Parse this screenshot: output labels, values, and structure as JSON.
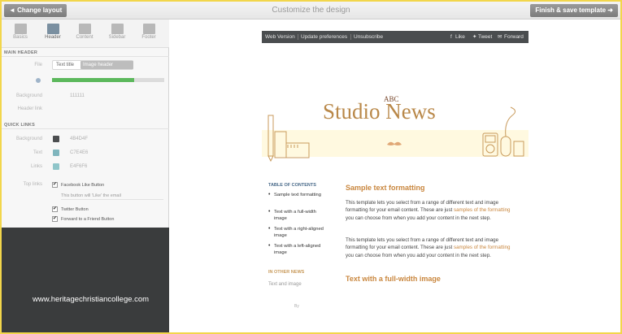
{
  "topbar": {
    "back_label": "◄ Change layout",
    "title": "Customize the design",
    "finish_label": "Finish & save template ➜"
  },
  "tabs": [
    {
      "label": "Basics",
      "icon": "scissors-icon"
    },
    {
      "label": "Header",
      "icon": "header-layout-icon"
    },
    {
      "label": "Content",
      "icon": "content-layout-icon"
    },
    {
      "label": "Sidebar",
      "icon": "sidebar-layout-icon"
    },
    {
      "label": "Footer",
      "icon": "footer-layout-icon"
    }
  ],
  "main_header": {
    "section": "MAIN HEADER",
    "file_label": "File",
    "seg_text": "Text title",
    "seg_image": "Image header",
    "slider_fraction": 0.73,
    "background_label": "Background",
    "background_value": "111111",
    "header_link_label": "Header link"
  },
  "quick_links": {
    "section": "QUICK LINKS",
    "rows": [
      {
        "label": "Background",
        "value": "4B4D4F",
        "color": "#4b4d4f"
      },
      {
        "label": "Text",
        "value": "C7E4E6",
        "color": "#7fb5bd"
      },
      {
        "label": "Links",
        "value": "E4F6F6",
        "color": "#8fc5c9"
      }
    ],
    "buttons_label": "Top links",
    "checks": [
      {
        "label": "Facebook Like Button",
        "checked": "✔"
      },
      {
        "label": "Twitter Button",
        "checked": "✔"
      },
      {
        "label": "Forward to a Friend Button",
        "checked": "✔"
      }
    ],
    "like_input": "This button will 'Like' the email"
  },
  "watermark": "www.heritagechristiancollege.com",
  "email": {
    "bar_links": [
      "Web Version",
      "Update preferences",
      "Unsubscribe"
    ],
    "social": [
      "Like",
      "Tweet",
      "Forward"
    ],
    "brand_small": "ABC",
    "brand_big": "Studio News",
    "toc_head": "TABLE OF CONTENTS",
    "toc": [
      "Sample text formatting",
      "Text with a full-width image",
      "Text with a right-aligned image",
      "Text with a left-aligned image"
    ],
    "news_head": "IN OTHER NEWS",
    "news_item": "Text and image",
    "by_text": "By",
    "h1": "Sample text formatting",
    "p1_a": "This template lets you select from a range of different text and image formatting for your email content. These are just ",
    "p1_link": "samples of the formatting",
    "p1_b": " you can choose from when you add your content in the next step.",
    "p2_a": "This template lets you select from a range of different text and image formatting for your email content. These are just ",
    "p2_link": "samples of the formatting",
    "p2_b": " you can choose from when you add your content in the next step.",
    "h2": "Text with a full-width image"
  },
  "colors": {
    "accent": "#c9873f",
    "frame": "#f2d64b",
    "slider": "#5cb85c",
    "email_bar": "#4a4d4f"
  }
}
